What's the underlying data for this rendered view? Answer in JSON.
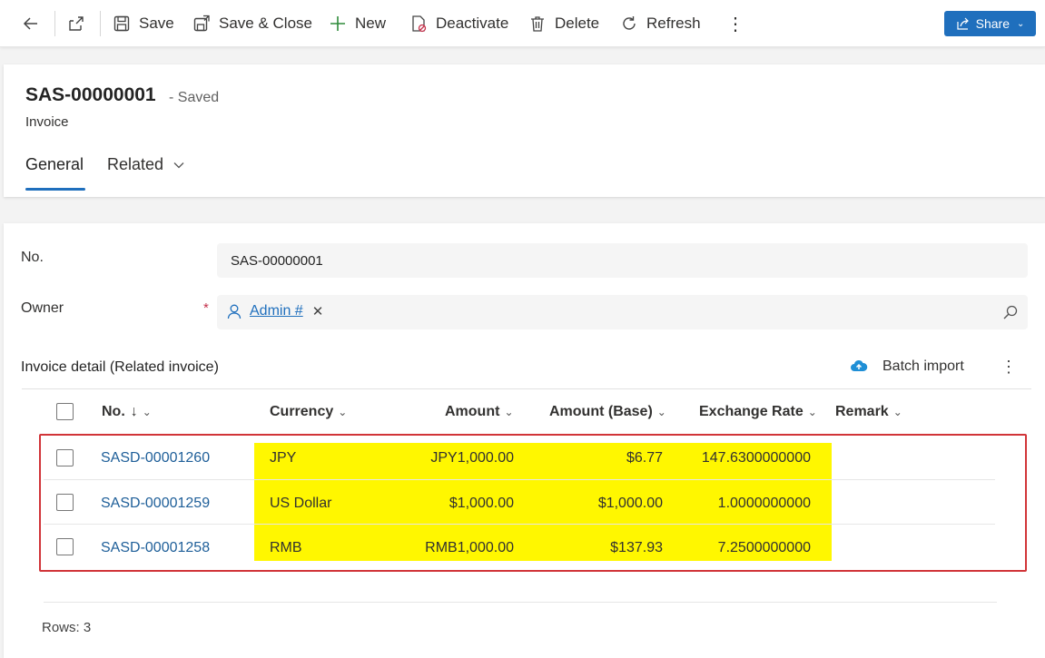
{
  "toolbar": {
    "save": "Save",
    "save_close": "Save & Close",
    "new": "New",
    "deactivate": "Deactivate",
    "delete": "Delete",
    "refresh": "Refresh",
    "share": "Share"
  },
  "record": {
    "id": "SAS-00000001",
    "status": "- Saved",
    "entity": "Invoice"
  },
  "tabs": [
    {
      "label": "General"
    },
    {
      "label": "Related"
    }
  ],
  "form": {
    "no_label": "No.",
    "no_value": "SAS-00000001",
    "owner_label": "Owner",
    "required_mark": "*",
    "owner_value": "Admin #"
  },
  "subgrid": {
    "title": "Invoice detail (Related invoice)",
    "batch_import": "Batch import",
    "columns": [
      "No.",
      "Currency",
      "Amount",
      "Amount (Base)",
      "Exchange Rate",
      "Remark"
    ],
    "rows": [
      {
        "no": "SASD-00001260",
        "currency": "JPY",
        "amount": "JPY1,000.00",
        "amount_base": "$6.77",
        "rate": "147.6300000000",
        "remark": ""
      },
      {
        "no": "SASD-00001259",
        "currency": "US Dollar",
        "amount": "$1,000.00",
        "amount_base": "$1,000.00",
        "rate": "1.0000000000",
        "remark": ""
      },
      {
        "no": "SASD-00001258",
        "currency": "RMB",
        "amount": "RMB1,000.00",
        "amount_base": "$137.93",
        "rate": "7.2500000000",
        "remark": ""
      }
    ],
    "rows_count": "Rows: 3"
  },
  "colors": {
    "accent": "#1f6fbd",
    "highlight": "#fff700",
    "annotation_red": "#d13438",
    "link": "#1f5f99"
  }
}
